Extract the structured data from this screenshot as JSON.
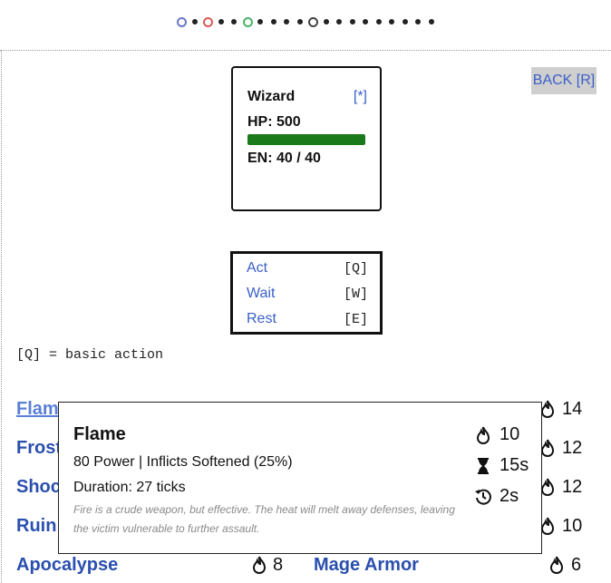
{
  "progress": {
    "total_steps": 20,
    "marked_steps": [
      {
        "index": 0,
        "color": "#6a78c8"
      },
      {
        "index": 2,
        "color": "#d85a5a"
      },
      {
        "index": 5,
        "color": "#4cb36a"
      },
      {
        "index": 10,
        "color": "#444444"
      }
    ]
  },
  "character": {
    "name": "Wizard",
    "link_label": "[*]",
    "hp_label": "HP: 500",
    "hp_fraction": 1.0,
    "en_label": "EN: 40 / 40",
    "hp_color": "#1a7a1a"
  },
  "back_button": "BACK [R]",
  "actions": [
    {
      "label": "Act",
      "key": "[Q]"
    },
    {
      "label": "Wait",
      "key": "[W]"
    },
    {
      "label": "Rest",
      "key": "[E]"
    }
  ],
  "hint": "[Q] = basic action",
  "spells": {
    "left": [
      {
        "name": "Flame",
        "visible": "Flam",
        "cost": ""
      },
      {
        "name": "Frost",
        "visible": "Frost",
        "cost": ""
      },
      {
        "name": "Shock",
        "visible": "Shoc",
        "cost": ""
      },
      {
        "name": "Ruin",
        "visible": "Ruin",
        "cost": ""
      },
      {
        "name": "Apocalypse",
        "visible": "Apocalypse",
        "cost": "8"
      }
    ],
    "right": [
      {
        "name": "",
        "cost": "14"
      },
      {
        "name": "",
        "cost": "12"
      },
      {
        "name": "",
        "cost": "12"
      },
      {
        "name": "",
        "cost": "10"
      },
      {
        "name": "Mage Armor",
        "cost": "6"
      }
    ]
  },
  "tooltip": {
    "title": "Flame",
    "line1": "80 Power | Inflicts Softened (25%)",
    "line2": "Duration: 27 ticks",
    "description": "Fire is a crude weapon, but effective. The heat will melt away defenses, leaving the victim vulnerable to further assault.",
    "stats": [
      {
        "icon": "flame-icon",
        "value": "10"
      },
      {
        "icon": "hourglass-icon",
        "value": "15s"
      },
      {
        "icon": "cooldown-icon",
        "value": "2s"
      }
    ]
  },
  "colors": {
    "link": "#3a5fc8",
    "spell": "#2a4fae",
    "text": "#111111"
  }
}
